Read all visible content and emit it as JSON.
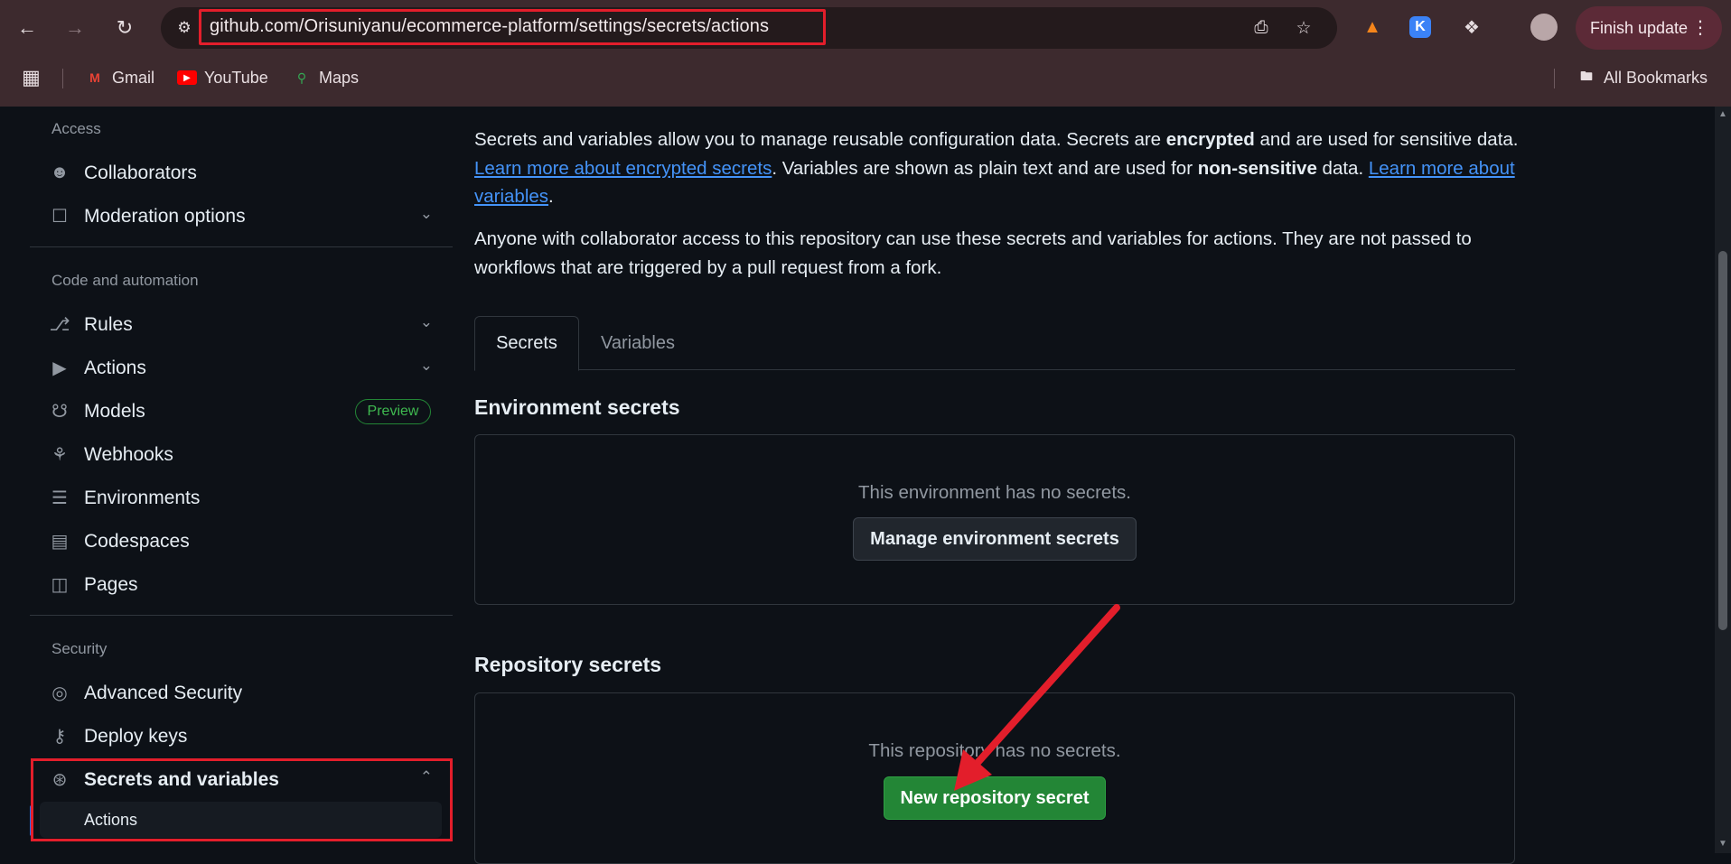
{
  "browser": {
    "url": "github.com/Orisuniyanu/ecommerce-platform/settings/secrets/actions",
    "finish_update_label": "Finish update",
    "bookmarks": [
      {
        "label": "Gmail",
        "icon": "gmail-icon"
      },
      {
        "label": "YouTube",
        "icon": "youtube-icon"
      },
      {
        "label": "Maps",
        "icon": "maps-icon"
      }
    ],
    "all_bookmarks_label": "All Bookmarks"
  },
  "sidebar": {
    "access_title": "Access",
    "collaborators": "Collaborators",
    "moderation": "Moderation options",
    "code_title": "Code and automation",
    "rules": "Rules",
    "actions": "Actions",
    "models": "Models",
    "preview_badge": "Preview",
    "webhooks": "Webhooks",
    "environments": "Environments",
    "codespaces": "Codespaces",
    "pages": "Pages",
    "security_title": "Security",
    "advanced_security": "Advanced Security",
    "deploy_keys": "Deploy keys",
    "secrets_variables": "Secrets and variables",
    "sub_actions": "Actions"
  },
  "main": {
    "intro_1": "Secrets and variables allow you to manage reusable configuration data. Secrets are ",
    "intro_encrypted": "encrypted",
    "intro_2": " and are used for sensitive data. ",
    "intro_link1": "Learn more about encrypted secrets",
    "intro_3": ". Variables are shown as plain text and are used for ",
    "intro_nonsensitive": "non-sensitive",
    "intro_4": " data. ",
    "intro_link2": "Learn more about variables",
    "intro_5": ".",
    "access_note": "Anyone with collaborator access to this repository can use these secrets and variables for actions. They are not passed to workflows that are triggered by a pull request from a fork.",
    "tabs": [
      "Secrets",
      "Variables"
    ],
    "env_title": "Environment secrets",
    "env_empty": "This environment has no secrets.",
    "env_button": "Manage environment secrets",
    "repo_title": "Repository secrets",
    "repo_empty": "This repository has no secrets.",
    "repo_button": "New repository secret"
  },
  "colors": {
    "annotation_red": "#e31e2b",
    "primary_green": "#238636",
    "link_blue": "#4493f8"
  }
}
